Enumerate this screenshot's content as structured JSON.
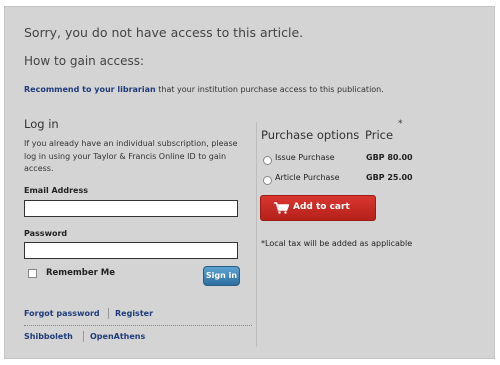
{
  "header": {
    "sorry_text": "Sorry, you do not have access to this article.",
    "how_title": "How to gain access:"
  },
  "recommend": {
    "link_text": "Recommend to your librarian",
    "rest_text": " that your institution purchase access to this publication."
  },
  "login": {
    "title": "Log in",
    "description": "If you already have an individual subscription, please log in using your Taylor & Francis Online ID to gain access.",
    "email_label": "Email Address",
    "email_value": "",
    "password_label": "Password",
    "password_value": "",
    "remember_label": "Remember Me",
    "remember_checked": false,
    "signin_label": "Sign in",
    "forgot_label": "Forgot password",
    "register_label": "Register",
    "shibboleth_label": "Shibboleth",
    "openathens_label": "OpenAthens"
  },
  "purchase": {
    "title": "Purchase options",
    "price_header": "Price",
    "price_asterisk": "*",
    "options": [
      {
        "label": "Issue Purchase",
        "price": "GBP 80.00",
        "selected": false
      },
      {
        "label": "Article Purchase",
        "price": "GBP 25.00",
        "selected": false
      }
    ],
    "add_to_cart_label": "Add to cart",
    "cart_icon": "shopping-cart-icon",
    "tax_note": "*Local tax will be added as applicable"
  },
  "colors": {
    "panel_background": "#d4d4d4",
    "link": "#1f3b7a",
    "add_to_cart": "#c8281f",
    "signin_button": "#3f83b6"
  }
}
